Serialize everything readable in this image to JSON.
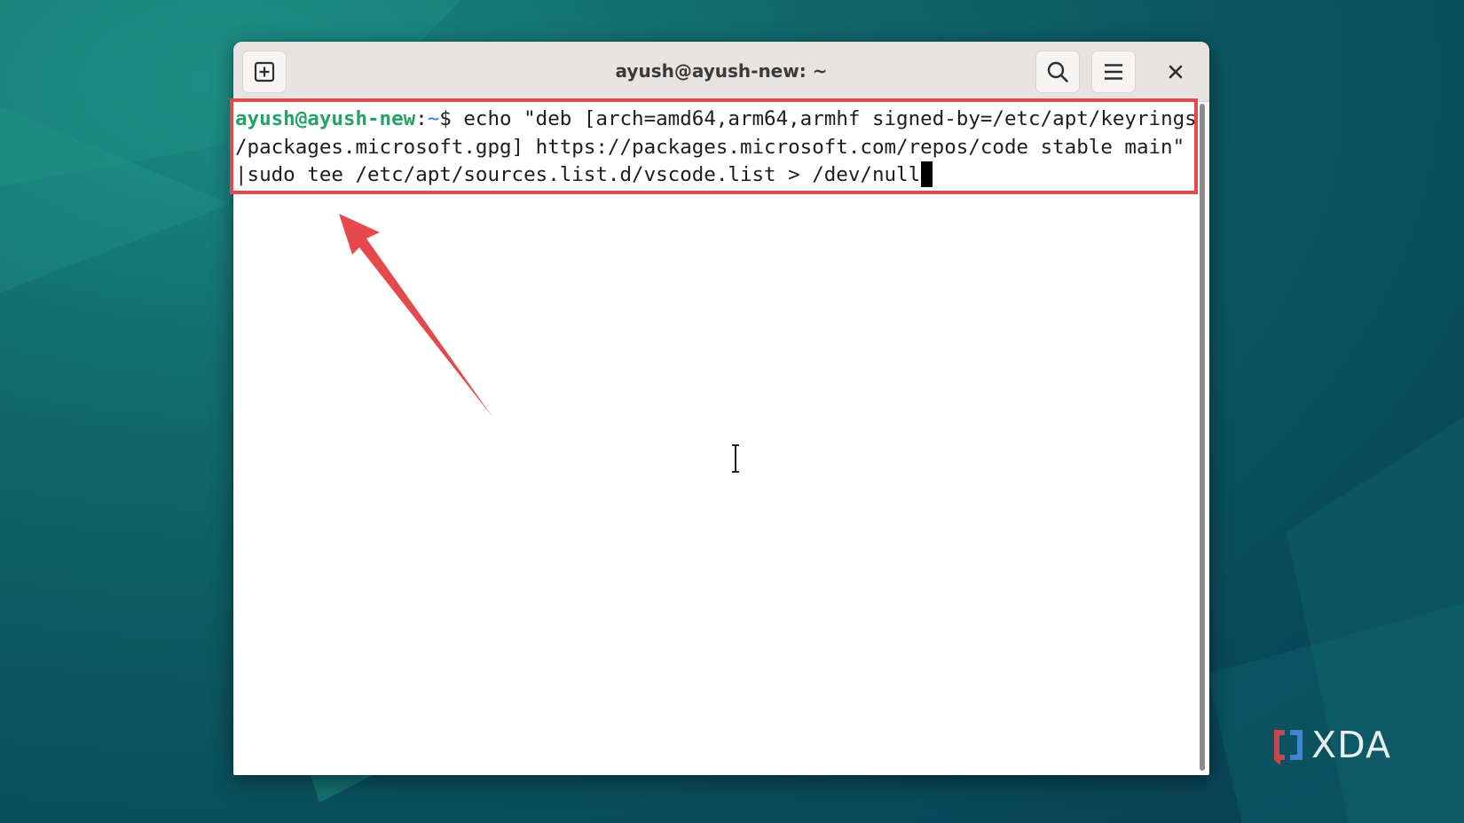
{
  "window": {
    "title": "ayush@ayush-new: ~"
  },
  "titlebar": {
    "new_tab_icon": "new-tab-icon",
    "search_icon": "search-icon",
    "menu_icon": "hamburger-menu-icon",
    "close_icon": "close-icon"
  },
  "terminal": {
    "prompt_user": "ayush@ayush-new",
    "prompt_sep": ":",
    "prompt_path": "~",
    "prompt_symbol": "$ ",
    "line1_cmd": "echo \"deb [arch=amd64,arm64,armhf signed-by=/etc/apt/keyrings",
    "line2": "/packages.microsoft.gpg] https://packages.microsoft.com/repos/code stable main\"",
    "line3": "|sudo tee /etc/apt/sources.list.d/vscode.list > /dev/null"
  },
  "annotation": {
    "highlight_color": "#e5484d",
    "arrow_color": "#e5484d"
  },
  "watermark": {
    "text": "XDA"
  },
  "colors": {
    "prompt_user": "#26a269",
    "prompt_path": "#2a7bde",
    "background": "#0c5862"
  }
}
